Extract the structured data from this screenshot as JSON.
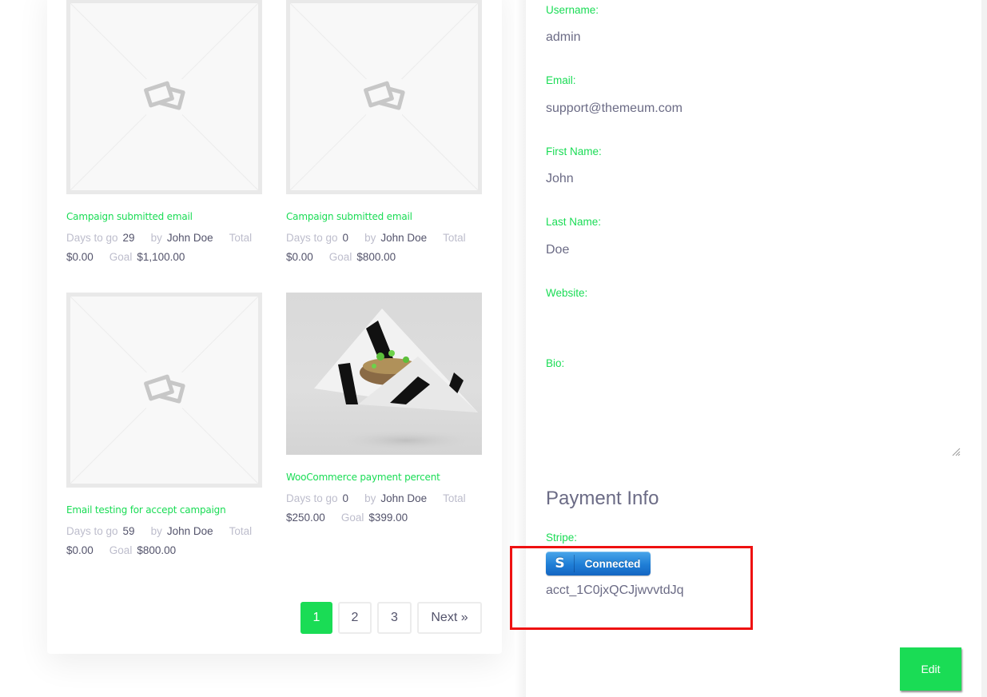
{
  "campaigns": [
    {
      "title": "Campaign submitted email",
      "image": "placeholder",
      "days_label": "Days to go",
      "days": "29",
      "by_label": "by",
      "author": "John Doe",
      "total_label": "Total",
      "total": "$0.00",
      "goal_label": "Goal",
      "goal": "$1,100.00"
    },
    {
      "title": "Campaign submitted email",
      "image": "placeholder",
      "days_label": "Days to go",
      "days": "0",
      "by_label": "by",
      "author": "John Doe",
      "total_label": "Total",
      "total": "$0.00",
      "goal_label": "Goal",
      "goal": "$800.00"
    },
    {
      "title": "Email testing for accept campaign",
      "image": "placeholder",
      "days_label": "Days to go",
      "days": "59",
      "by_label": "by",
      "author": "John Doe",
      "total_label": "Total",
      "total": "$0.00",
      "goal_label": "Goal",
      "goal": "$800.00"
    },
    {
      "title": "WooCommerce payment percent",
      "image": "food-photo",
      "days_label": "Days to go",
      "days": "0",
      "by_label": "by",
      "author": "John Doe",
      "total_label": "Total",
      "total": "$250.00",
      "goal_label": "Goal",
      "goal": "$399.00"
    }
  ],
  "pagination": {
    "pages": [
      "1",
      "2",
      "3"
    ],
    "current": "1",
    "next_label": "Next »"
  },
  "profile": {
    "username_label": "Username:",
    "username": "admin",
    "email_label": "Email:",
    "email": "support@themeum.com",
    "first_name_label": "First Name:",
    "first_name": "John",
    "last_name_label": "Last Name:",
    "last_name": "Doe",
    "website_label": "Website:",
    "website": "",
    "bio_label": "Bio:",
    "bio": ""
  },
  "payment": {
    "section_title": "Payment Info",
    "stripe_label": "Stripe:",
    "stripe_button_icon": "S",
    "stripe_button_label": "Connected",
    "account_id": "acct_1C0jxQCJjwvvtdJq"
  },
  "edit_label": "Edit",
  "colors": {
    "accent": "#1adc55",
    "text": "#6b6b85",
    "highlight": "#ee1111",
    "stripe_blue": "#1f7ed6"
  }
}
